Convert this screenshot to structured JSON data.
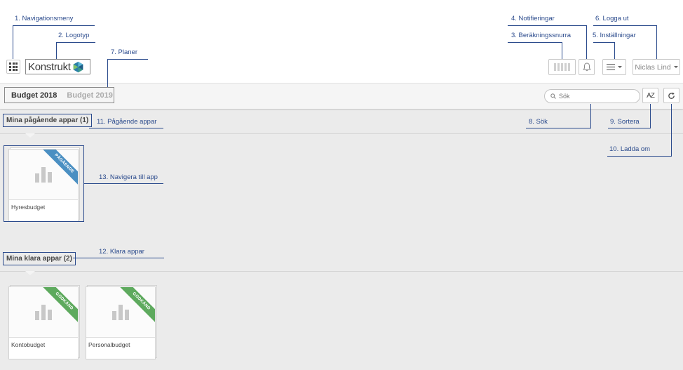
{
  "annotations": {
    "nav_menu": "1. Navigationsmeny",
    "logo": "2. Logotyp",
    "spinner": "3. Beräkningssnurra",
    "notifications": "4. Notifieringar",
    "settings": "5. Inställningar",
    "logout": "6. Logga ut",
    "plans": "7. Planer",
    "search": "8. Sök",
    "sort": "9. Sortera",
    "reload": "10. Ladda om",
    "ongoing_apps": "11. Pågående appar",
    "done_apps": "12. Klara appar",
    "navigate_app": "13. Navigera till app"
  },
  "header": {
    "logo_text": "Konstrukt",
    "user_name": "Niclas Lind"
  },
  "plans": {
    "active": "Budget 2018",
    "inactive": "Budget 2019"
  },
  "toolbar": {
    "search_placeholder": "Sök",
    "sort_label": "AZ"
  },
  "sections": {
    "ongoing": {
      "title": "Mina pågående appar (1)",
      "apps": [
        {
          "name": "Hyresbudget",
          "ribbon": "PÅGÅENDE"
        }
      ]
    },
    "done": {
      "title": "Mina klara appar (2)",
      "apps": [
        {
          "name": "Kontobudget",
          "ribbon": "GODKÄND"
        },
        {
          "name": "Personalbudget",
          "ribbon": "GODKÄND"
        }
      ]
    }
  },
  "colors": {
    "annotation": "#2a4a8c",
    "ribbon_ongoing": "#4a8fc2",
    "ribbon_done": "#5eaa5e"
  },
  "icons": [
    "grid-icon",
    "logo-mark-icon",
    "spinner-icon",
    "bell-icon",
    "menu-icon",
    "search-icon",
    "refresh-icon",
    "chart-icon"
  ]
}
